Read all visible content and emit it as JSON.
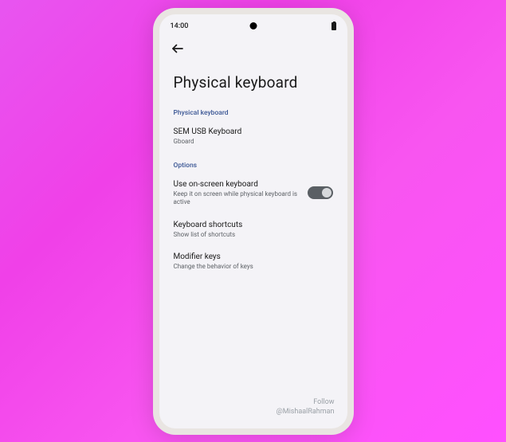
{
  "status": {
    "time": "14:00"
  },
  "page": {
    "title": "Physical keyboard"
  },
  "sections": {
    "keyboard": {
      "header": "Physical keyboard",
      "device": {
        "title": "SEM USB Keyboard",
        "subtitle": "Gboard"
      }
    },
    "options": {
      "header": "Options",
      "onscreen": {
        "title": "Use on-screen keyboard",
        "subtitle": "Keep it on screen while physical keyboard is active"
      },
      "shortcuts": {
        "title": "Keyboard shortcuts",
        "subtitle": "Show list of shortcuts"
      },
      "modifier": {
        "title": "Modifier keys",
        "subtitle": "Change the behavior of keys"
      }
    }
  },
  "watermark": {
    "line1": "Follow",
    "line2": "@MishaalRahman"
  }
}
